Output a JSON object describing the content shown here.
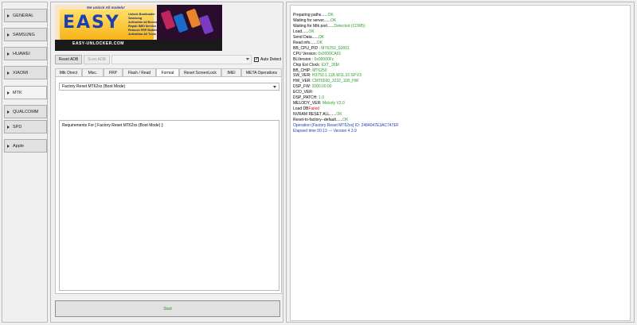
{
  "sidebar": {
    "items": [
      {
        "label": "GENERAL"
      },
      {
        "label": "SAMSUNG"
      },
      {
        "label": "HUAWEI"
      },
      {
        "label": "XIAOMI"
      },
      {
        "label": "MTK"
      },
      {
        "label": "QUALCOMM"
      },
      {
        "label": "SPD"
      },
      {
        "label": "Apple"
      }
    ],
    "active": "MTK"
  },
  "banner": {
    "logo_text": "EASY",
    "tagline": "We unlock All models!",
    "website": "EASY-UNLOCKER.COM",
    "features": [
      "Unlock Bootloader Samsung",
      "Activation all Boxes",
      "Repair IMEI Service",
      "Remove FRP Mobile",
      "Activation All Tools"
    ]
  },
  "adb": {
    "reset_label": "Reset ADB",
    "scan_label": "Scan ADB",
    "auto_detect_label": "Auto Detect",
    "auto_detect_checked": true
  },
  "tabs": [
    {
      "label": "Mtk Direct"
    },
    {
      "label": "Misc."
    },
    {
      "label": "FRP"
    },
    {
      "label": "Flash / Read"
    },
    {
      "label": "Format"
    },
    {
      "label": "Reset ScreenLock"
    },
    {
      "label": "IMEI"
    },
    {
      "label": "META Operations"
    }
  ],
  "active_tab": "Format",
  "format": {
    "mode_selected": "Factory Reset  MT62xx (Boot Mode)",
    "requirements": "Requirements For [ Factory Reset  MT62xx (Boot Mode) ]:"
  },
  "start_label": "Start",
  "colors": {
    "ok": "#2e9b2e",
    "fail": "#d62020",
    "info": "#1f3fb5"
  },
  "log": [
    {
      "k": "Preparing paths......",
      "v": "OK",
      "c": "ok"
    },
    {
      "k": "Waiting for server......",
      "v": "OK",
      "c": "ok"
    },
    {
      "k": "Waiting for Mtk port......",
      "v": "Detected (COM5)",
      "c": "ok"
    },
    {
      "k": "Load......",
      "v": "OK",
      "c": "ok"
    },
    {
      "k": "Send Data......",
      "v": "OK",
      "c": "ok"
    },
    {
      "k": "Read info......",
      "v": "OK",
      "c": "ok"
    },
    {
      "k": "BB_CPU_PID : ",
      "v": "MT6250_S0001",
      "c": "ok"
    },
    {
      "k": "CPU Version: ",
      "v": "0x0000CA01",
      "c": "ok"
    },
    {
      "k": "BLVersion : ",
      "v": "0x00000Fc",
      "c": "ok"
    },
    {
      "k": "Chip Ext Clock: ",
      "v": "EXT_26M",
      "c": "ok"
    },
    {
      "k": "BB_CHIP: ",
      "v": "MT6250",
      "c": "ok"
    },
    {
      "k": "SW_VER: ",
      "v": "H3750.1.11B.W11.32.SP.V3",
      "c": "ok"
    },
    {
      "k": "HW_VER: ",
      "v": "CMT6500_3232_11B_HW",
      "c": "ok"
    },
    {
      "k": "DSP_FW: ",
      "v": "2000.00.00",
      "c": "ok"
    },
    {
      "k": "ECO_VER:",
      "v": "",
      "c": "ok"
    },
    {
      "k": "DSP_PATCH: ",
      "v": "1.0",
      "c": "ok"
    },
    {
      "k": "MELODY_VER: ",
      "v": "Melody V3.0",
      "c": "ok"
    },
    {
      "k": "Load DB",
      "v": "Failed",
      "c": "red"
    },
    {
      "k": "NVRAM RESET ALL......",
      "v": "OK",
      "c": "ok"
    },
    {
      "k": "Reset-to-factory--default......",
      "v": "OK",
      "c": "ok"
    },
    {
      "k": "Operation [Factory Reset MT62xx] ID: 2484047E3AC747EF",
      "v": "",
      "c": "blue"
    },
    {
      "k": "Elapsed time 00:13 --- Version 4.3.9",
      "v": "",
      "c": "blue"
    }
  ]
}
